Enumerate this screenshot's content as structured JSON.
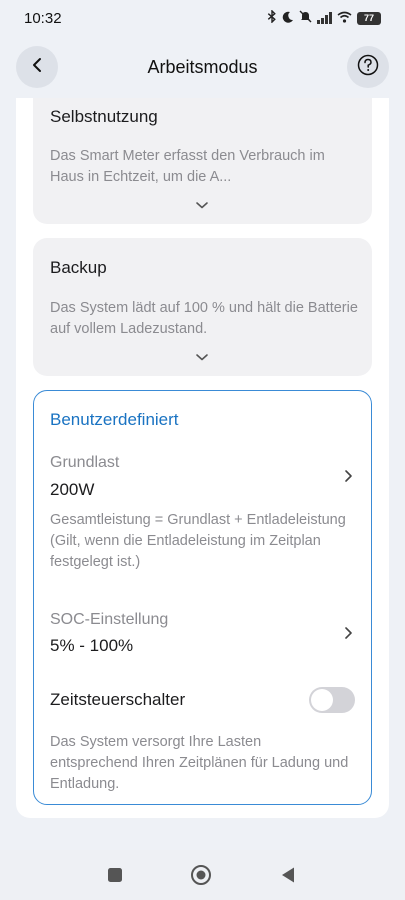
{
  "status_bar": {
    "time": "10:32",
    "battery": "77",
    "icons": [
      "bluetooth-icon",
      "moon-icon",
      "mute-icon",
      "signal-icon",
      "wifi-icon",
      "battery-icon"
    ]
  },
  "header": {
    "title": "Arbeitsmodus",
    "back_icon": "chevron-left-icon",
    "help_icon": "question-circle-icon"
  },
  "modes": {
    "self_use": {
      "title": "Selbstnutzung",
      "description": "Das Smart Meter erfasst den Verbrauch im Haus in Echtzeit, um die A..."
    },
    "backup": {
      "title": "Backup",
      "description": "Das System lädt auf 100 % und hält die Batterie auf vollem Ladezustand."
    },
    "custom": {
      "title": "Benutzerdefiniert",
      "base_load_label": "Grundlast",
      "base_load_value": "200W",
      "base_load_info": "Gesamtleistung = Grundlast + Entladeleistung (Gilt, wenn die Entladeleistung im Zeitplan festgelegt ist.)",
      "soc_label": "SOC-Einstellung",
      "soc_value": "5% - 100%",
      "timer_switch_label": "Zeitsteuerschalter",
      "timer_switch_on": false,
      "timer_info": "Das System versorgt Ihre Lasten entsprechend Ihren Zeitplänen für Ladung und Entladung."
    }
  },
  "colors": {
    "accent": "#1a73c2",
    "selected_border": "#3a8bd6",
    "background": "#eef1f6"
  },
  "nav_bar": {
    "icons": [
      "recents-square-icon",
      "home-circle-icon",
      "back-triangle-icon"
    ]
  }
}
